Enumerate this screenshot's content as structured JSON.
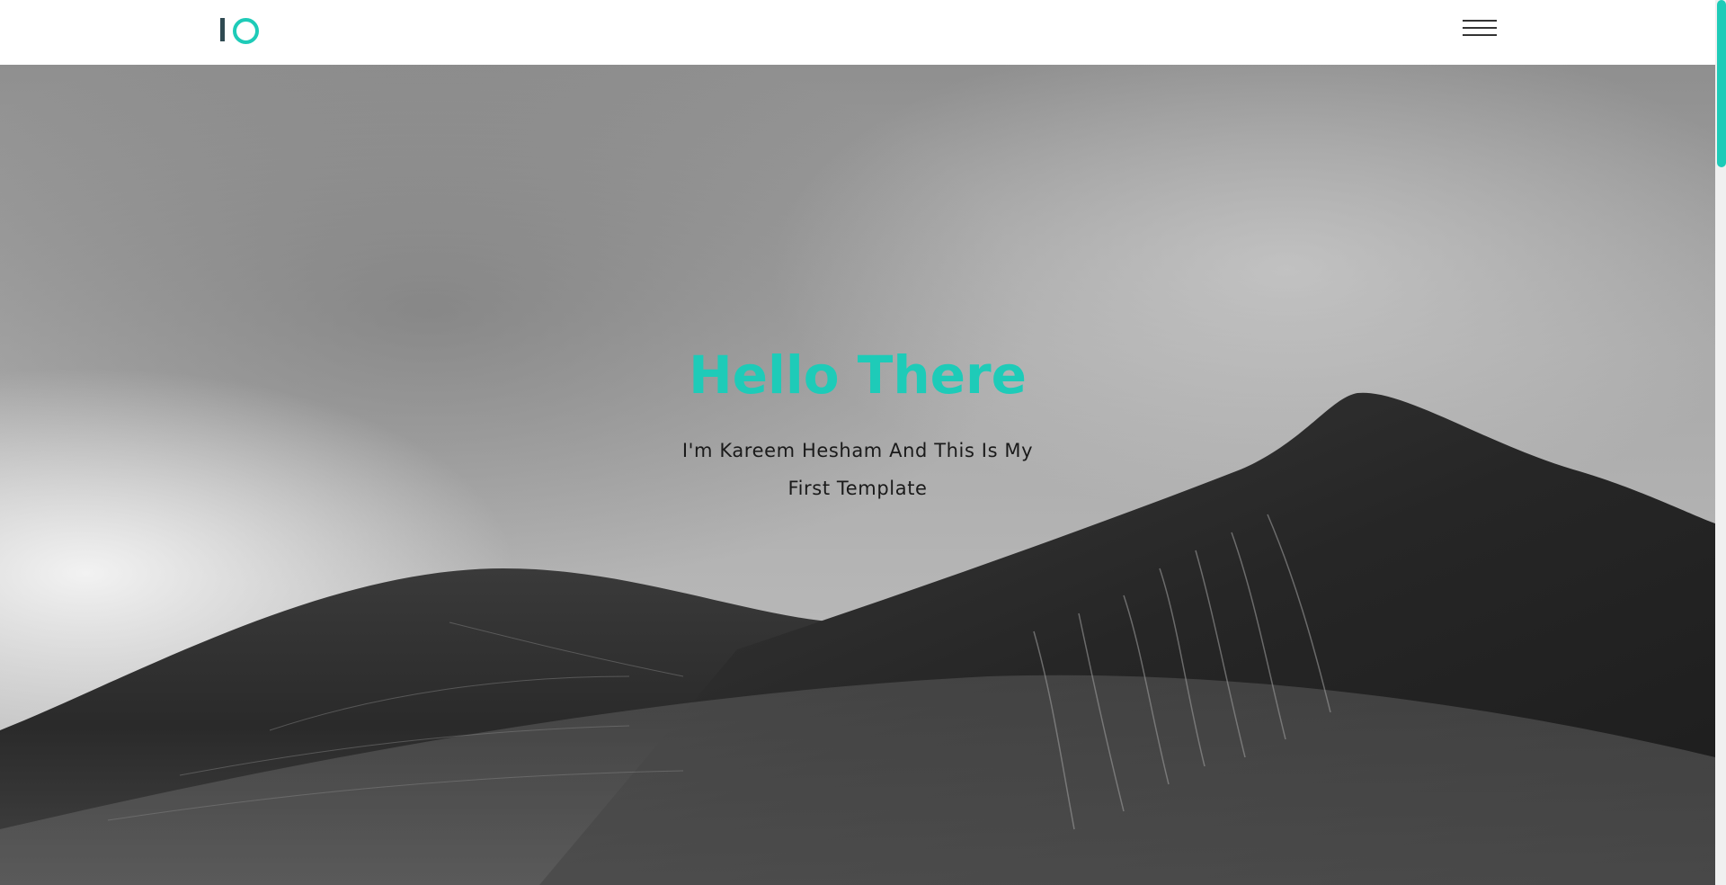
{
  "header": {
    "logo_icon": "io-logo-icon",
    "menu_icon": "hamburger-menu-icon"
  },
  "hero": {
    "title": "Hello There",
    "subtitle": "I'm Kareem Hesham And This Is My First Template",
    "background": "black-and-white-mountain-photo"
  },
  "colors": {
    "accent": "#1ecbb8",
    "logo_bar": "#2f4a52",
    "text_dark": "#1a1a1a",
    "header_bg": "#ffffff"
  }
}
